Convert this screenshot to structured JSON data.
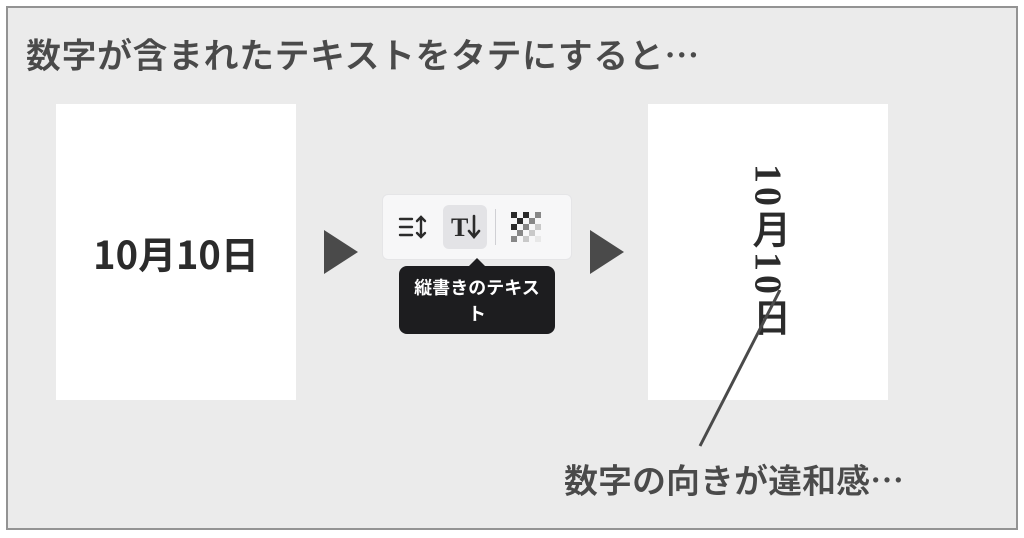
{
  "title": "数字が含まれたテキストをタテにすると…",
  "sample_text": "10月10日",
  "toolbar": {
    "tooltip": "縦書きのテキスト",
    "icons": {
      "spacing": "line-spacing-icon",
      "vertical": "vertical-text-icon",
      "transparency": "transparency-icon"
    }
  },
  "caption": "数字の向きが違和感…"
}
